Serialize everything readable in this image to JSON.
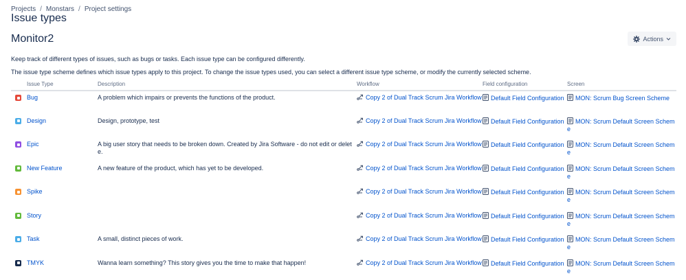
{
  "breadcrumb": [
    "Projects",
    "Monstars",
    "Project settings"
  ],
  "page_title": "Issue types",
  "project_name": "Monitor2",
  "actions_label": "Actions",
  "description_1": "Keep track of different types of issues, such as bugs or tasks. Each issue type can be configured differently.",
  "description_2": "The issue type scheme defines which issue types apply to this project. To change the issue types used, you can select a different issue type scheme, or modify the currently selected scheme.",
  "columns": {
    "issue_type": "Issue Type",
    "description": "Description",
    "workflow": "Workflow",
    "field_configuration": "Field configuration",
    "screen": "Screen"
  },
  "rows": [
    {
      "name": "Bug",
      "icon": "bug-icon",
      "color": "#e5493a",
      "description": "A problem which impairs or prevents the functions of the product.",
      "workflow": "Copy 2 of Dual Track Scrum Jira Workflow",
      "field_config": "Default Field Configuration",
      "screen": "MON: Scrum Bug Screen Scheme"
    },
    {
      "name": "Design",
      "icon": "design-icon",
      "color": "#4bade8",
      "description": "Design, prototype, test",
      "workflow": "Copy 2 of Dual Track Scrum Jira Workflow",
      "field_config": "Default Field Configuration",
      "screen": "MON: Scrum Default Screen Scheme"
    },
    {
      "name": "Epic",
      "icon": "epic-icon",
      "color": "#904ee2",
      "description": "A big user story that needs to be broken down. Created by Jira Software - do not edit or delete.",
      "workflow": "Copy 2 of Dual Track Scrum Jira Workflow",
      "field_config": "Default Field Configuration",
      "screen": "MON: Scrum Default Screen Scheme"
    },
    {
      "name": "New Feature",
      "icon": "new-feature-icon",
      "color": "#63ba3c",
      "description": "A new feature of the product, which has yet to be developed.",
      "workflow": "Copy 2 of Dual Track Scrum Jira Workflow",
      "field_config": "Default Field Configuration",
      "screen": "MON: Scrum Default Screen Scheme"
    },
    {
      "name": "Spike",
      "icon": "spike-icon",
      "color": "#f79232",
      "description": "",
      "workflow": "Copy 2 of Dual Track Scrum Jira Workflow",
      "field_config": "Default Field Configuration",
      "screen": "MON: Scrum Default Screen Scheme"
    },
    {
      "name": "Story",
      "icon": "story-icon",
      "color": "#63ba3c",
      "description": "",
      "workflow": "Copy 2 of Dual Track Scrum Jira Workflow",
      "field_config": "Default Field Configuration",
      "screen": "MON: Scrum Default Screen Scheme"
    },
    {
      "name": "Task",
      "icon": "task-icon",
      "color": "#4bade8",
      "description": "A small, distinct pieces of work.",
      "workflow": "Copy 2 of Dual Track Scrum Jira Workflow",
      "field_config": "Default Field Configuration",
      "screen": "MON: Scrum Default Screen Scheme"
    },
    {
      "name": "TMYK",
      "icon": "tmyk-icon",
      "color": "#172b4d",
      "description": "Wanna learn something? This story gives you the time to make that happen!",
      "workflow": "Copy 2 of Dual Track Scrum Jira Workflow",
      "field_config": "Default Field Configuration",
      "screen": "MON: Scrum Default Screen Scheme"
    }
  ]
}
